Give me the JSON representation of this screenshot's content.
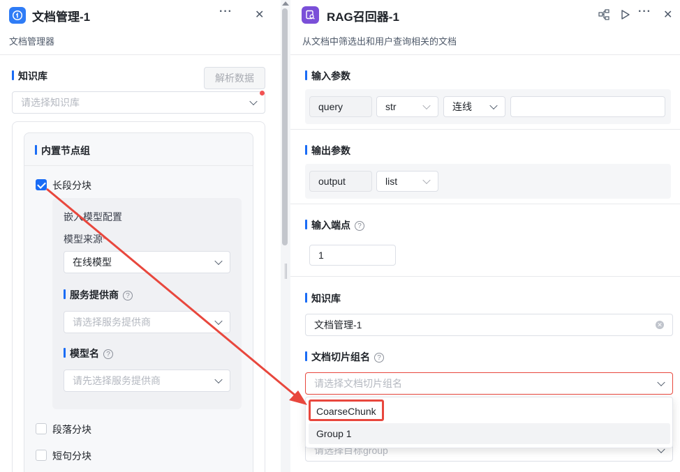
{
  "left_panel": {
    "title": "文档管理-1",
    "subtitle": "文档管理器",
    "more_icon": "more-icon",
    "close_icon": "close-icon",
    "kb_label": "知识库",
    "parse_button": "解析数据",
    "kb_placeholder": "请选择知识库",
    "group_title": "内置节点组",
    "long_chunk": {
      "label": "长段分块",
      "checked": true,
      "embed_config": "嵌入模型配置",
      "model_source_label": "模型来源",
      "model_source_value": "在线模型",
      "provider_label": "服务提供商",
      "provider_placeholder": "请选择服务提供商",
      "model_name_label": "模型名",
      "model_name_placeholder": "请先选择服务提供商"
    },
    "paragraph_chunk": "段落分块",
    "sentence_chunk": "短句分块",
    "required_mark": "*"
  },
  "right_panel": {
    "title": "RAG召回器-1",
    "subtitle": "从文档中筛选出和用户查询相关的文档",
    "input_params_label": "输入参数",
    "input_param": {
      "name": "query",
      "type": "str",
      "source": "连线",
      "value": ""
    },
    "output_params_label": "输出参数",
    "output_param": {
      "name": "output",
      "type": "list"
    },
    "input_port_label": "输入端点",
    "input_port_value": "1",
    "kb_label": "知识库",
    "kb_value": "文档管理-1",
    "chunk_group_label": "文档切片组名",
    "chunk_group_placeholder": "请选择文档切片组名",
    "dropdown_options": [
      "CoarseChunk",
      "Group 1"
    ],
    "target_group_placeholder": "请选择目标group"
  },
  "colors": {
    "accent": "#1a6cf5",
    "annotation": "#e8473d",
    "rag_icon": "#7a4fd8"
  }
}
